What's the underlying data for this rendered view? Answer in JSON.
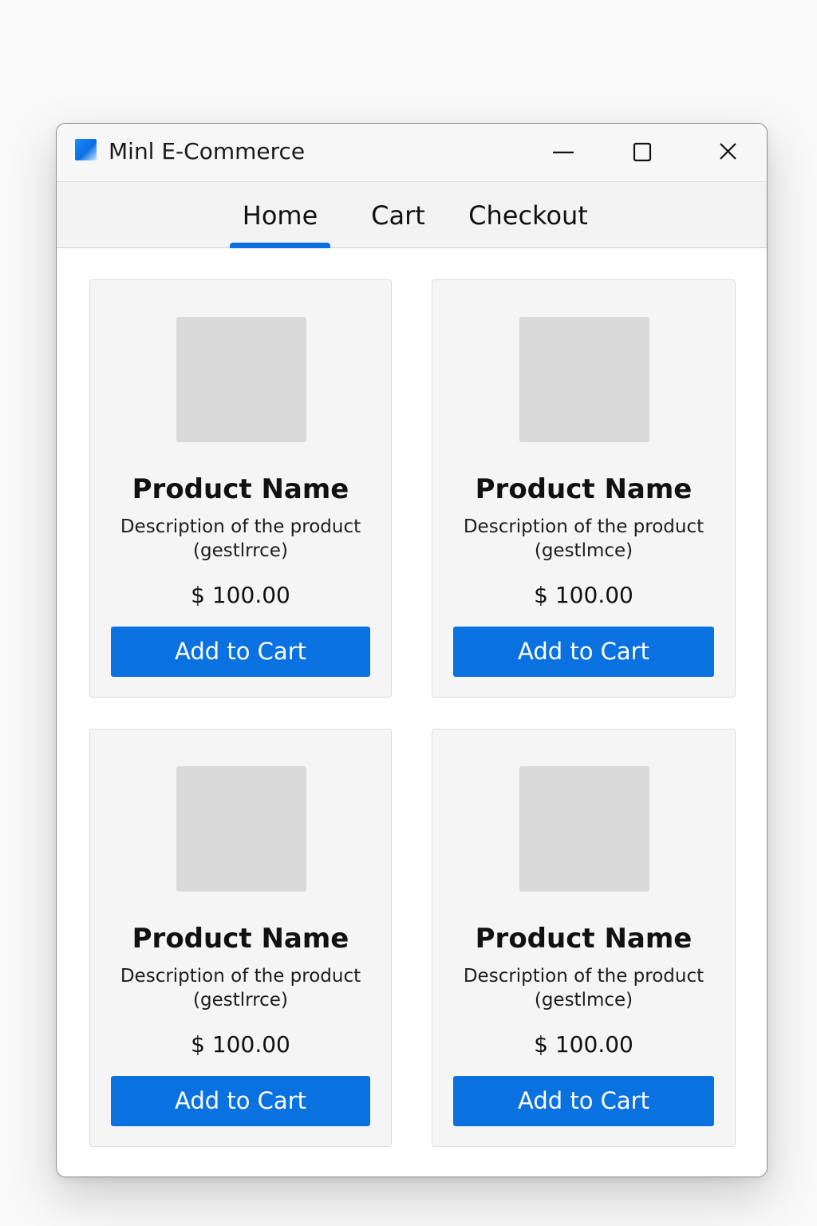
{
  "window": {
    "title": "Minl E-Commerce",
    "minimize_icon": "minimize-icon",
    "maximize_icon": "maximize-icon",
    "close_icon": "close-icon"
  },
  "nav": {
    "tabs": [
      {
        "label": "Home",
        "active": true
      },
      {
        "label": "Cart",
        "active": false
      },
      {
        "label": "Checkout",
        "active": false
      }
    ]
  },
  "colors": {
    "accent": "#0a72e0",
    "card_bg": "#f5f5f5",
    "thumb_bg": "#d9d9d9"
  },
  "products": [
    {
      "name": "Product Name",
      "description": "Description of the product\n(gestlrrce)",
      "price": "$ 100.00",
      "button_label": "Add to Cart"
    },
    {
      "name": "Product Name",
      "description": "Description of the product\n(gestlmce)",
      "price": "$ 100.00",
      "button_label": "Add to Cart"
    },
    {
      "name": "Product Name",
      "description": "Description of the product\n(gestlrrce)",
      "price": "$ 100.00",
      "button_label": "Add to Cart"
    },
    {
      "name": "Product Name",
      "description": "Description of the product\n(gestlmce)",
      "price": "$ 100.00",
      "button_label": "Add to Cart"
    }
  ]
}
